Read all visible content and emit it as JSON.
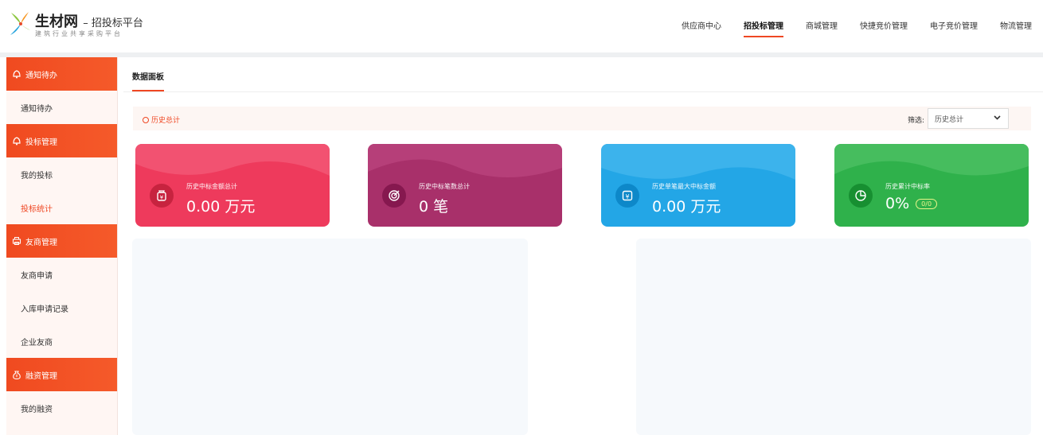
{
  "brand": {
    "name": "生材网",
    "subtitle": "– 招投标平台",
    "slogan": "建筑行业共享采购平台",
    "accent": "#ef4723"
  },
  "top_nav": {
    "items": [
      {
        "label": "供应商中心"
      },
      {
        "label": "招投标管理",
        "active": true
      },
      {
        "label": "商城管理"
      },
      {
        "label": "快捷竞价管理"
      },
      {
        "label": "电子竞价管理"
      },
      {
        "label": "物流管理"
      }
    ]
  },
  "sidebar": {
    "groups": [
      {
        "label": "通知待办",
        "icon": "bell-icon",
        "items": [
          {
            "label": "通知待办"
          }
        ]
      },
      {
        "label": "投标管理",
        "icon": "bell-icon",
        "items": [
          {
            "label": "我的投标"
          },
          {
            "label": "投标统计",
            "active": true
          }
        ]
      },
      {
        "label": "友商管理",
        "icon": "printer-icon",
        "items": [
          {
            "label": "友商申请"
          },
          {
            "label": "入库申请记录"
          },
          {
            "label": "企业友商"
          }
        ]
      },
      {
        "label": "融资管理",
        "icon": "money-bag-icon",
        "items": [
          {
            "label": "我的融资"
          }
        ]
      }
    ]
  },
  "main": {
    "tab_label": "数据面板",
    "history_label": "历史总计",
    "filter_label": "筛选:",
    "filter_value": "历史总计",
    "cards": [
      {
        "label": "历史中标金额总计",
        "value": "0.00 万元",
        "icon": "money-bag-icon",
        "color": "#ee3a5c"
      },
      {
        "label": "历史中标笔数总计",
        "value": "0 笔",
        "icon": "target-icon",
        "color": "#a8306a"
      },
      {
        "label": "历史单笔最大中标金额",
        "value": "0.00 万元",
        "icon": "yuan-icon",
        "color": "#23a6e6"
      },
      {
        "label": "历史累计中标率",
        "value": "0%",
        "badge": "0/0",
        "icon": "pie-chart-icon",
        "color": "#2fb14b"
      }
    ]
  }
}
